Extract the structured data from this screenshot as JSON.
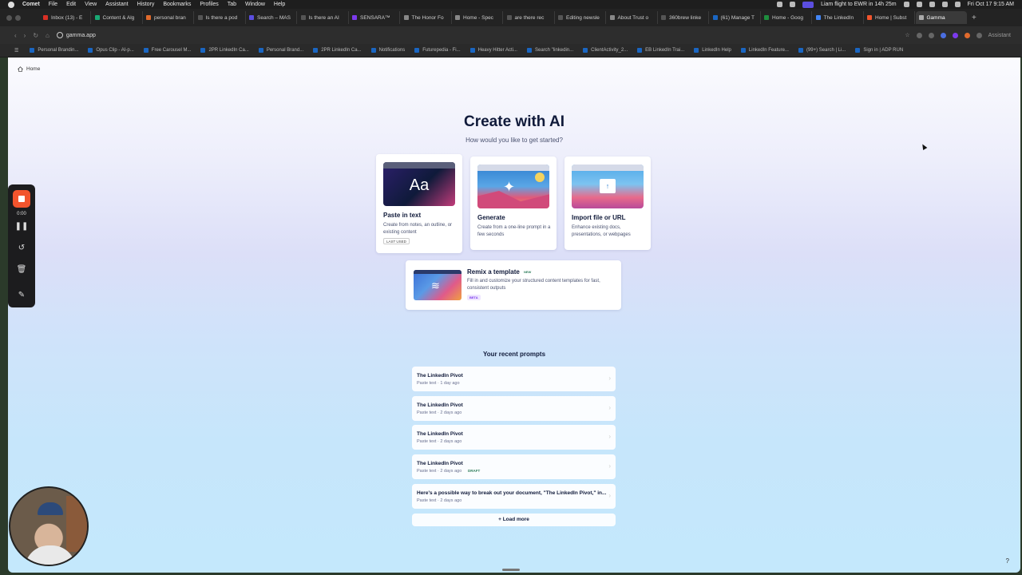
{
  "menubar": {
    "app": "Comet",
    "items": [
      "File",
      "Edit",
      "View",
      "Assistant",
      "History",
      "Bookmarks",
      "Profiles",
      "Tab",
      "Window",
      "Help"
    ],
    "flight_status": "Liam flight to EWR in 14h 25m",
    "datetime": "Fri Oct 17  9:15 AM"
  },
  "tabs": [
    {
      "label": "Inbox (13) - E",
      "color": "#d93025"
    },
    {
      "label": "Content & Alg",
      "color": "#19a974"
    },
    {
      "label": "personal bran",
      "color": "#e06a2c"
    },
    {
      "label": "Is there a pod",
      "color": "#555555"
    },
    {
      "label": "Search – MAS",
      "color": "#5b4ee0"
    },
    {
      "label": "Is there an AI",
      "color": "#555555"
    },
    {
      "label": "SENSARA™",
      "color": "#7c3aed"
    },
    {
      "label": "The Honor Fo",
      "color": "#888888"
    },
    {
      "label": "Home - Spec",
      "color": "#888888"
    },
    {
      "label": "are there rec",
      "color": "#555555"
    },
    {
      "label": "Editing newsle",
      "color": "#555555"
    },
    {
      "label": "About Trust o",
      "color": "#888888"
    },
    {
      "label": "360brew linke",
      "color": "#555555"
    },
    {
      "label": "(61) Manage T",
      "color": "#1a66c2"
    },
    {
      "label": "Home - Goog",
      "color": "#1e8e3e"
    },
    {
      "label": "The LinkedIn",
      "color": "#4285f4"
    },
    {
      "label": "Home | Subst",
      "color": "#f2542d"
    },
    {
      "label": "Gamma",
      "color": "#aaaaaa",
      "active": true
    }
  ],
  "address": {
    "url": "gamma.app",
    "assistant_label": "Assistant"
  },
  "bookmarks": [
    "Personal Brandin...",
    "Opus Clip - AI-p...",
    "Free Carousel M...",
    "2PR LinkedIn Ca...",
    "Personal Brand...",
    "2PR LinkedIn Ca...",
    "Notifications",
    "Futurepedia - Fi...",
    "Heavy Hitter Acti...",
    "Search \"linkedin...",
    "ClientActivity_2...",
    "EB LinkedIn Trai...",
    "LinkedIn Help",
    "LinkedIn Feature...",
    "(99+) Search | Li...",
    "Sign in | ADP RUN"
  ],
  "page": {
    "breadcrumb": "Home",
    "title": "Create with AI",
    "subtitle": "How would you like to get started?",
    "cards": {
      "paste": {
        "title": "Paste in text",
        "desc": "Create from notes, an outline, or existing content",
        "badge": "LAST USED",
        "thumb_text": "Aa"
      },
      "generate": {
        "title": "Generate",
        "desc": "Create from a one-line prompt in a few seconds"
      },
      "import": {
        "title": "Import file or URL",
        "desc": "Enhance existing docs, presentations, or webpages"
      }
    },
    "remix": {
      "title": "Remix a template",
      "new_tag": "NEW",
      "desc": "Fill in and customize your structured content templates for fast, consistent outputs",
      "beta_tag": "BETA"
    },
    "recent_heading": "Your recent prompts",
    "recent": [
      {
        "title": "The LinkedIn Pivot",
        "meta": "Paste text · 1 day ago"
      },
      {
        "title": "The LinkedIn Pivot",
        "meta": "Paste text · 2 days ago"
      },
      {
        "title": "The LinkedIn Pivot",
        "meta": "Paste text · 2 days ago"
      },
      {
        "title": "The LinkedIn Pivot",
        "meta": "Paste text · 2 days ago",
        "tag": "DRAFT"
      },
      {
        "title": "Here's a possible way to break out your document, \"The LinkedIn Pivot,\" in...",
        "meta": "Paste text · 2 days ago"
      }
    ],
    "load_more": "Load more",
    "help": "?"
  },
  "recorder": {
    "time": "0:00"
  }
}
